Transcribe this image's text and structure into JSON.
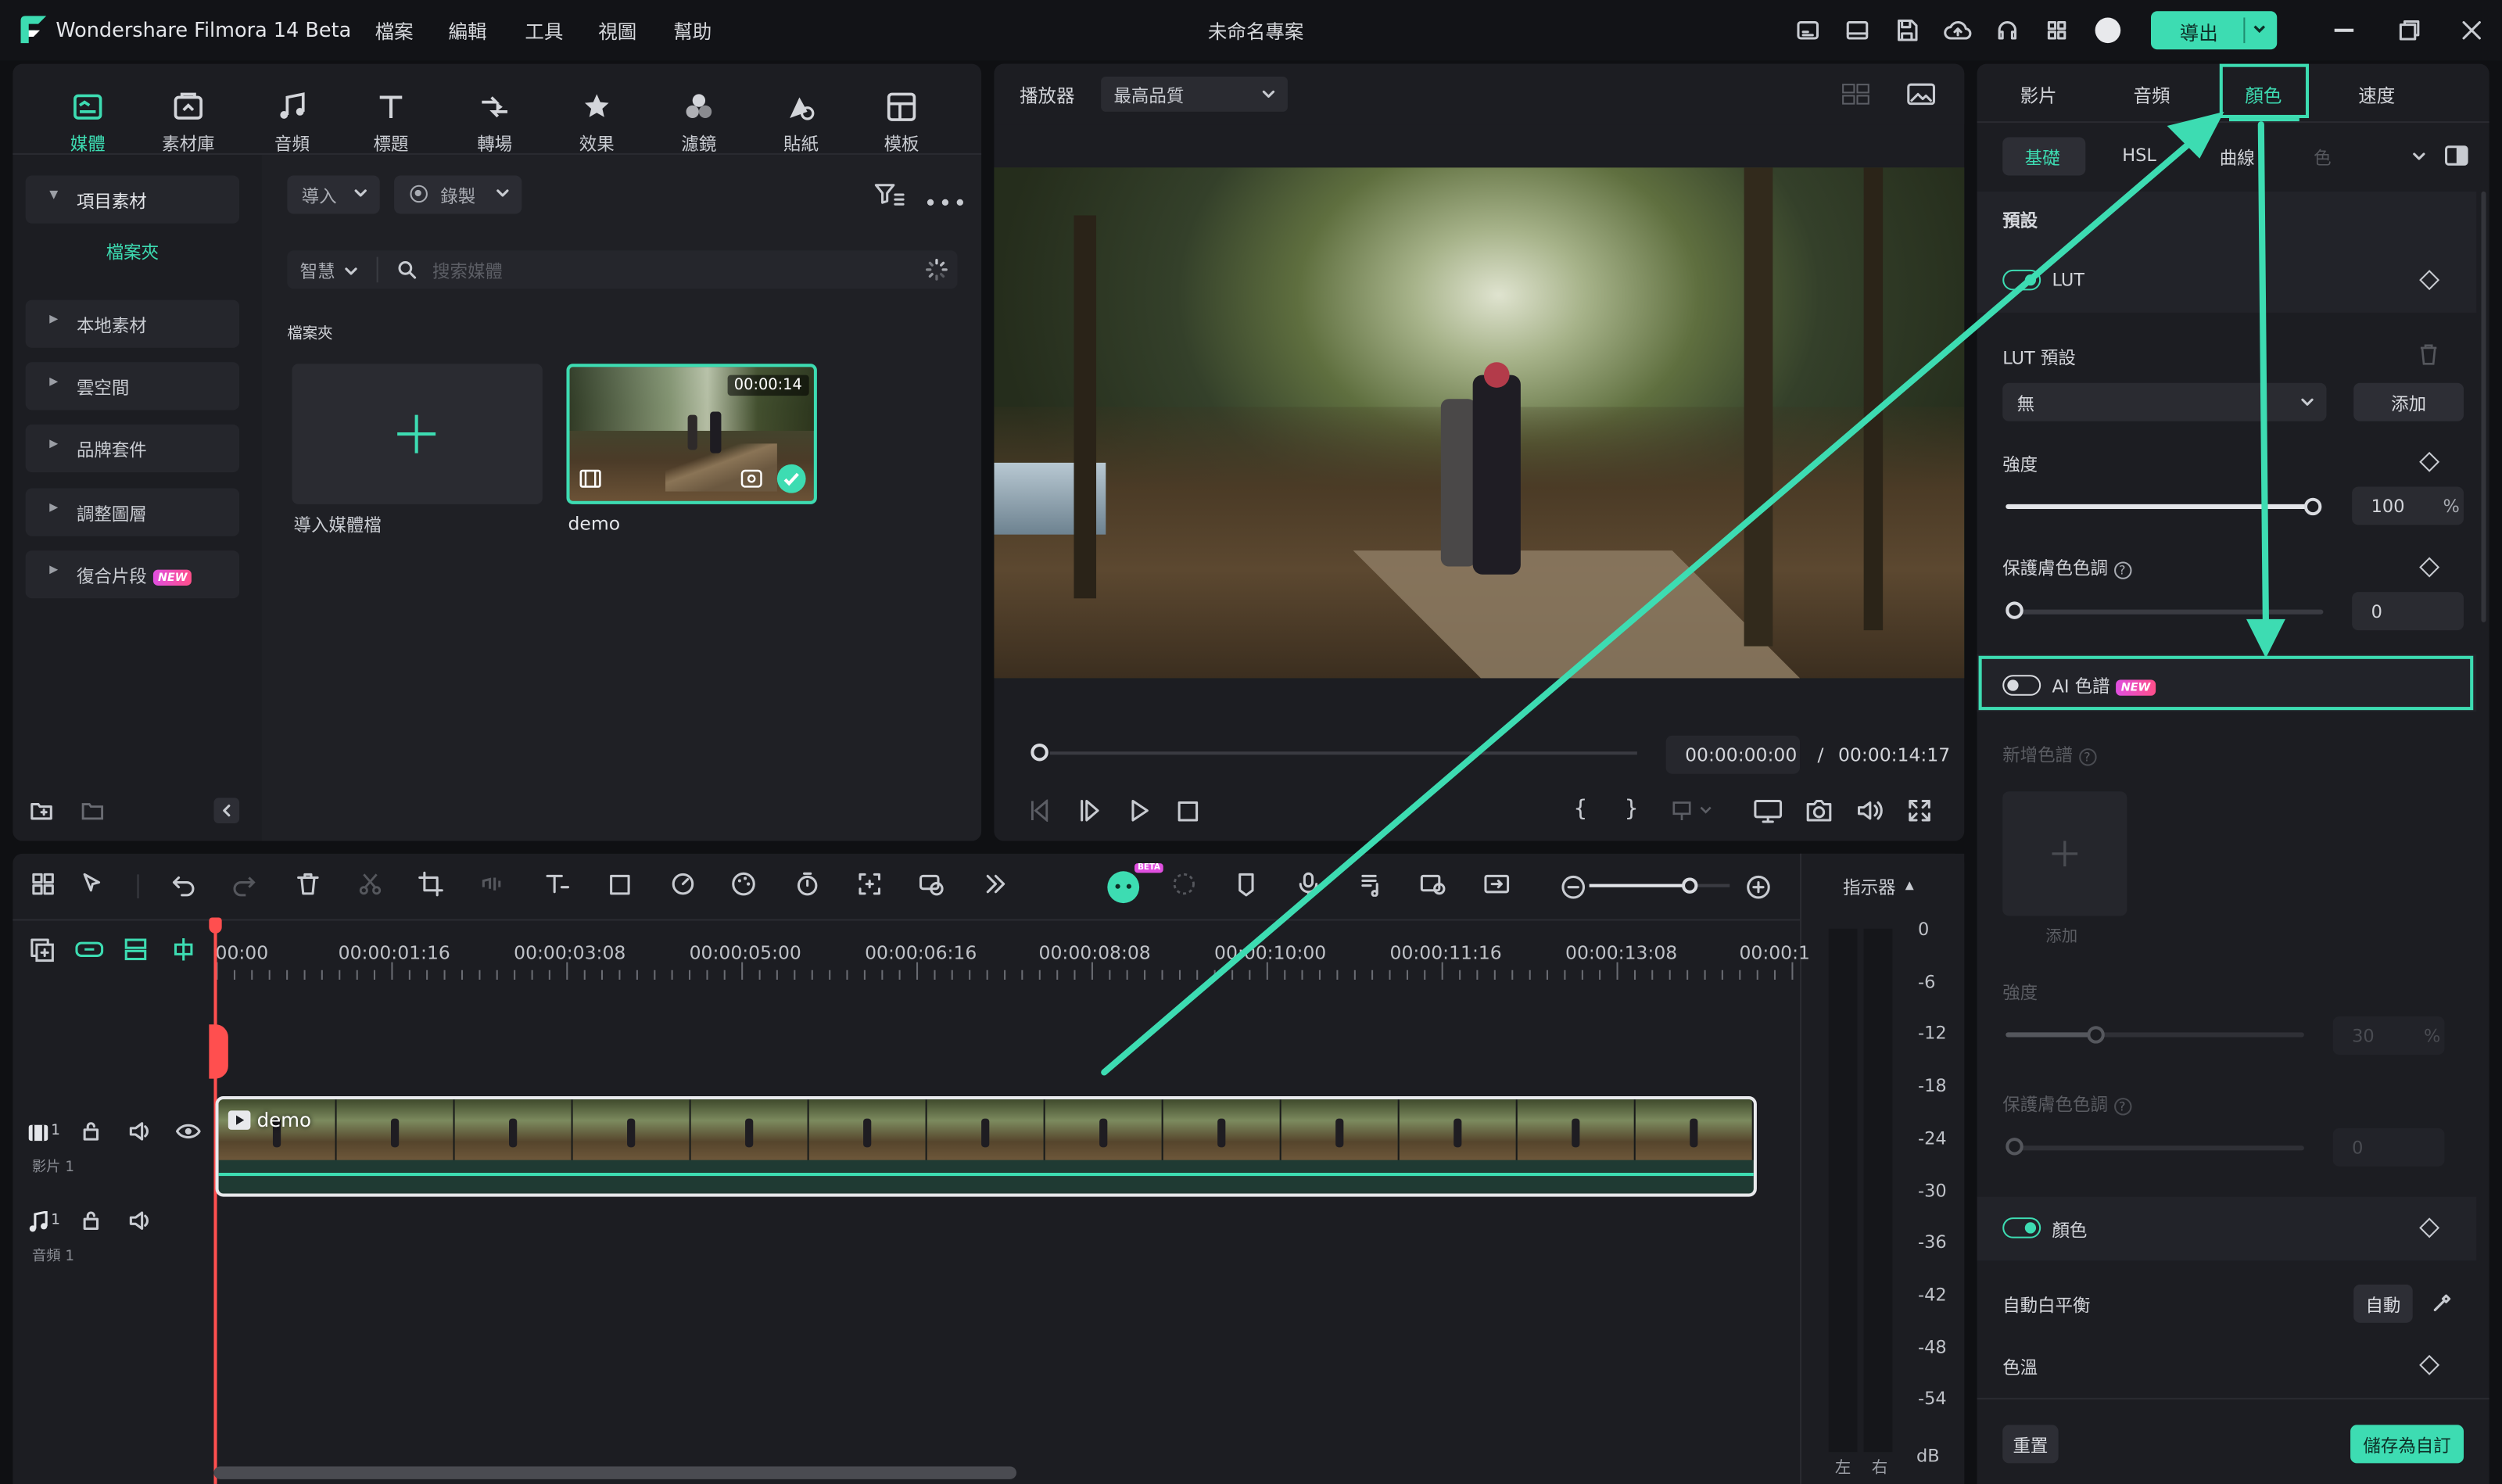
{
  "app": {
    "title": "Wondershare Filmora 14 Beta",
    "project": "未命名專案",
    "export_label": "導出"
  },
  "menu": [
    "檔案",
    "編輯",
    "工具",
    "視圖",
    "幫助"
  ],
  "toolbar": [
    {
      "label": "媒體",
      "icon": "media-icon",
      "active": true
    },
    {
      "label": "素材庫",
      "icon": "stock-library-icon",
      "active": false
    },
    {
      "label": "音頻",
      "icon": "music-note-icon",
      "active": false
    },
    {
      "label": "標題",
      "icon": "title-text-icon",
      "active": false
    },
    {
      "label": "轉場",
      "icon": "transition-icon",
      "active": false
    },
    {
      "label": "效果",
      "icon": "effects-star-icon",
      "active": false
    },
    {
      "label": "濾鏡",
      "icon": "filter-icon",
      "active": false
    },
    {
      "label": "貼紙",
      "icon": "sticker-icon",
      "active": false
    },
    {
      "label": "模板",
      "icon": "template-icon",
      "active": false
    }
  ],
  "sidebar": {
    "project_media": "項目素材",
    "folder": "檔案夾",
    "items": [
      "本地素材",
      "雲空間",
      "品牌套件",
      "調整圖層",
      "復合片段"
    ],
    "new_badge": "NEW"
  },
  "media": {
    "import_label": "導入",
    "record_label": "錄製",
    "smart_label": "智慧",
    "search_placeholder": "搜索媒體",
    "folder_heading": "檔案夾",
    "import_tile_label": "導入媒體檔",
    "clip_name": "demo",
    "clip_duration": "00:00:14"
  },
  "player": {
    "label": "播放器",
    "quality": "最高品質",
    "current_time": "00:00:00:00",
    "separator": "/",
    "total_time": "00:00:14:17",
    "progress": 0
  },
  "timeline": {
    "ruler": [
      "00:00",
      "00:00:01:16",
      "00:00:03:08",
      "00:00:05:00",
      "00:00:06:16",
      "00:00:08:08",
      "00:00:10:00",
      "00:00:11:16",
      "00:00:13:08",
      "00:00:1"
    ],
    "clip_name": "demo",
    "video_track_label": "影片 1",
    "audio_track_label": "音頻 1",
    "video_track_num": "1",
    "audio_track_num": "1",
    "meter_label": "指示器",
    "db_scale": [
      "0",
      "-6",
      "-12",
      "-18",
      "-24",
      "-30",
      "-36",
      "-42",
      "-48",
      "-54"
    ],
    "db_unit": "dB",
    "left_label": "左",
    "right_label": "右",
    "beta_badge": "BETA",
    "zoom": 0.72
  },
  "props": {
    "tabs": [
      "影片",
      "音頻",
      "顏色",
      "速度"
    ],
    "active_tab": "顏色",
    "subtabs": [
      "基礎",
      "HSL",
      "曲線",
      "色"
    ],
    "preset_heading": "預設",
    "lut_label": "LUT",
    "lut_preset_label": "LUT 預設",
    "lut_value": "無",
    "add_label": "添加",
    "strength_label": "強度",
    "strength_value": "100",
    "percent": "%",
    "protect_skin_label": "保護膚色色調",
    "protect_skin_value": "0",
    "ai_palette_label": "AI 色譜",
    "new_palette_label": "新增色譜",
    "add_tile_label": "添加",
    "ai_strength_label": "強度",
    "ai_strength_value": "30",
    "ai_protect_label": "保護膚色色調",
    "ai_protect_value": "0",
    "color_label": "顏色",
    "auto_wb_label": "自動白平衡",
    "auto_label": "自動",
    "temperature_label": "色溫",
    "reset_label": "重置",
    "save_custom_label": "儲存為自訂",
    "strength_level": 1.0,
    "ai_strength_level": 0.3
  },
  "colors": {
    "accent": "#3ddcb2",
    "panel": "#1c1d22",
    "bg": "#0f1013",
    "playhead": "#ff4f4f"
  }
}
